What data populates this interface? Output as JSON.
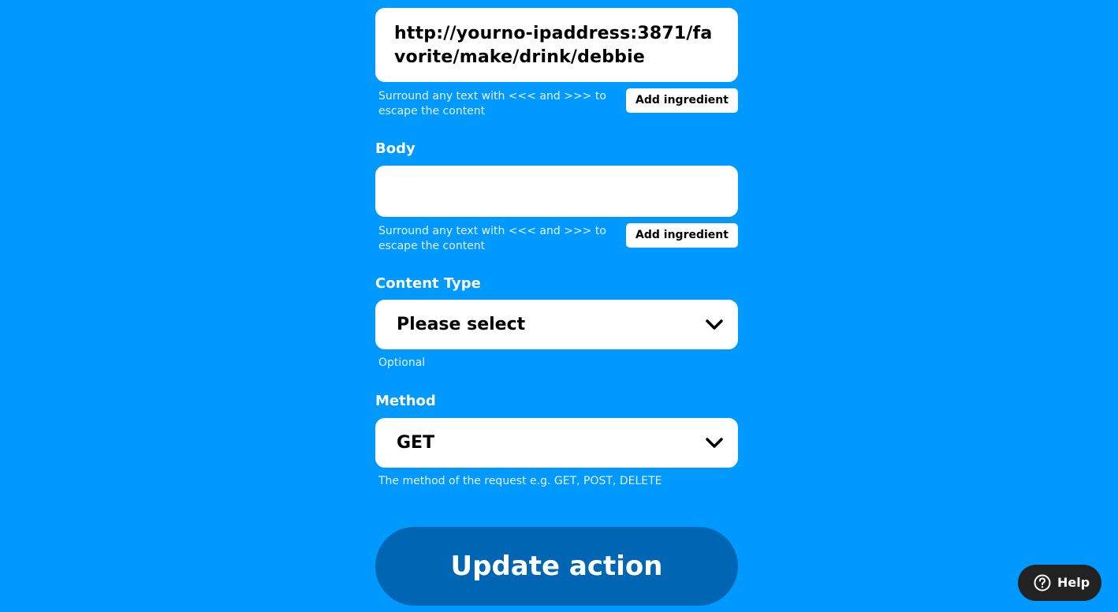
{
  "url_field": {
    "value": "http://yourno-ipaddress:3871/favorite/make/drink/debbie",
    "helper": "Surround any text with <<< and >>> to escape the content",
    "ingredient_button": "Add ingredient"
  },
  "body_field": {
    "label": "Body",
    "value": "",
    "helper": "Surround any text with <<< and >>> to escape the content",
    "ingredient_button": "Add ingredient"
  },
  "content_type": {
    "label": "Content Type",
    "selected": "Please select",
    "helper": "Optional",
    "icon": "chevron-down-icon"
  },
  "method": {
    "label": "Method",
    "selected": "GET",
    "helper": "The method of the request e.g. GET, POST, DELETE",
    "icon": "chevron-down-icon"
  },
  "update_button": "Update action",
  "help_button": {
    "label": "Help",
    "icon": "question-circle-icon"
  },
  "colors": {
    "background": "#0099ff",
    "update_button": "#0066b3",
    "help_button": "#222222"
  }
}
